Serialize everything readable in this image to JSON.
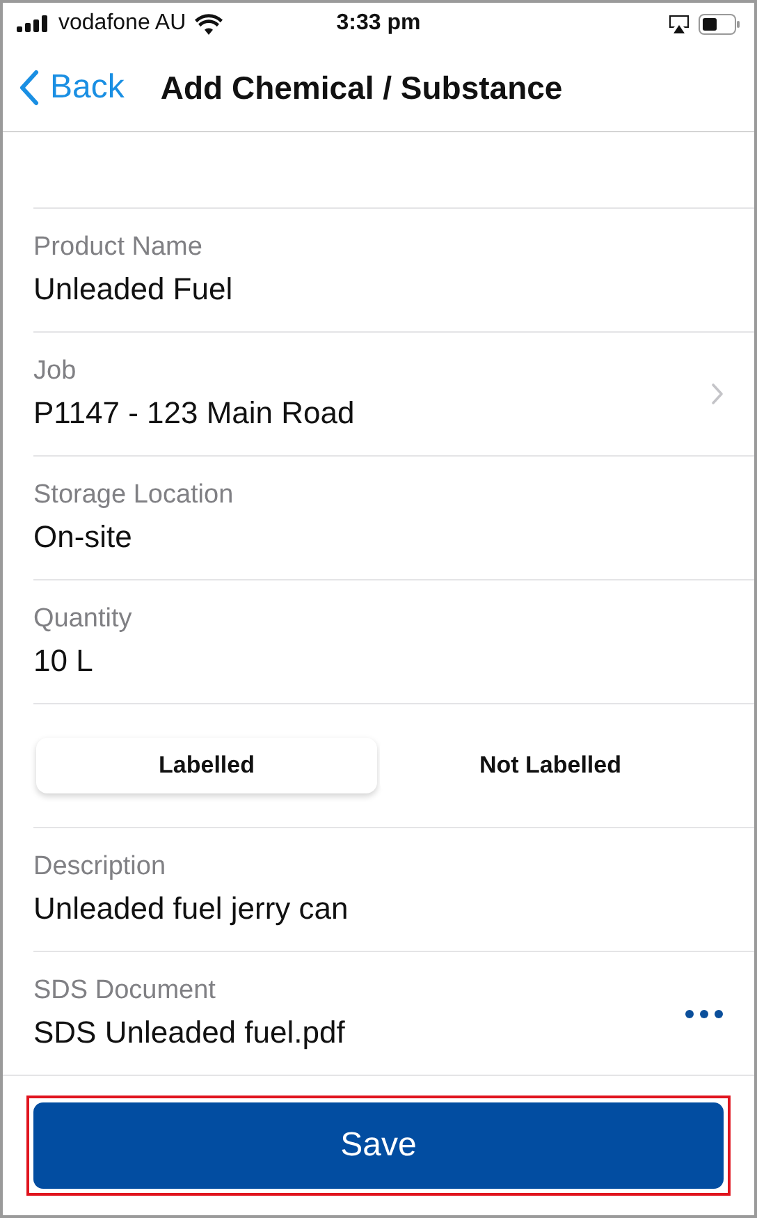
{
  "status_bar": {
    "carrier": "vodafone AU",
    "time": "3:33 pm"
  },
  "nav": {
    "back": "Back",
    "title": "Add Chemical / Substance"
  },
  "rows": [
    {
      "kind": "text",
      "label": "Product Name",
      "value": "Unleaded Fuel"
    },
    {
      "kind": "link",
      "label": "Job",
      "value": "P1147 - 123 Main Road"
    },
    {
      "kind": "text",
      "label": "Storage Location",
      "value": "On-site"
    },
    {
      "kind": "text",
      "label": "Quantity",
      "value": "10 L"
    },
    {
      "kind": "segmented",
      "options": [
        {
          "label": "Labelled",
          "selected": true
        },
        {
          "label": "Not Labelled",
          "selected": false
        }
      ]
    },
    {
      "kind": "text",
      "label": "Description",
      "value": "Unleaded fuel jerry can"
    },
    {
      "kind": "file",
      "label": "SDS Document",
      "value": "SDS Unleaded fuel.pdf"
    }
  ],
  "save_button": {
    "label": "Save",
    "highlighted": true
  }
}
